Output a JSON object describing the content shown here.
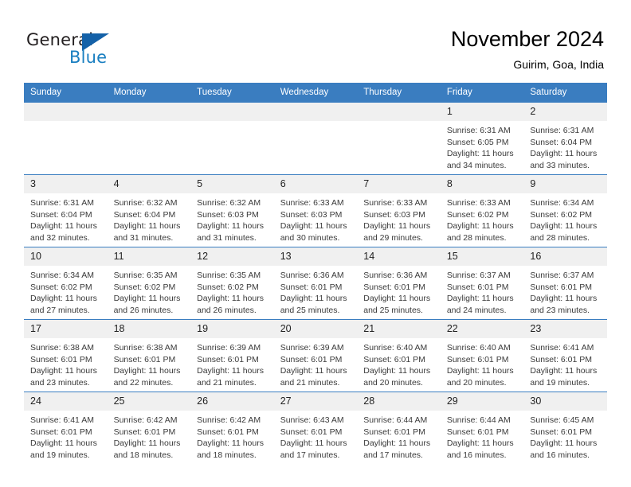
{
  "branding": {
    "logo_text_primary": "General",
    "logo_text_secondary": "Blue",
    "logo_accent_color": "#1461a8",
    "logo_secondary_color": "#1a7fc1"
  },
  "header": {
    "month_title": "November 2024",
    "location": "Guirim, Goa, India"
  },
  "calendar": {
    "header_background": "#3a7dc0",
    "daycell_background": "#f0f0f0",
    "weekdays": [
      "Sunday",
      "Monday",
      "Tuesday",
      "Wednesday",
      "Thursday",
      "Friday",
      "Saturday"
    ],
    "weeks": [
      [
        {
          "day": "",
          "empty": true
        },
        {
          "day": "",
          "empty": true
        },
        {
          "day": "",
          "empty": true
        },
        {
          "day": "",
          "empty": true
        },
        {
          "day": "",
          "empty": true
        },
        {
          "day": "1",
          "sunrise": "Sunrise: 6:31 AM",
          "sunset": "Sunset: 6:05 PM",
          "daylight": "Daylight: 11 hours and 34 minutes."
        },
        {
          "day": "2",
          "sunrise": "Sunrise: 6:31 AM",
          "sunset": "Sunset: 6:04 PM",
          "daylight": "Daylight: 11 hours and 33 minutes."
        }
      ],
      [
        {
          "day": "3",
          "sunrise": "Sunrise: 6:31 AM",
          "sunset": "Sunset: 6:04 PM",
          "daylight": "Daylight: 11 hours and 32 minutes."
        },
        {
          "day": "4",
          "sunrise": "Sunrise: 6:32 AM",
          "sunset": "Sunset: 6:04 PM",
          "daylight": "Daylight: 11 hours and 31 minutes."
        },
        {
          "day": "5",
          "sunrise": "Sunrise: 6:32 AM",
          "sunset": "Sunset: 6:03 PM",
          "daylight": "Daylight: 11 hours and 31 minutes."
        },
        {
          "day": "6",
          "sunrise": "Sunrise: 6:33 AM",
          "sunset": "Sunset: 6:03 PM",
          "daylight": "Daylight: 11 hours and 30 minutes."
        },
        {
          "day": "7",
          "sunrise": "Sunrise: 6:33 AM",
          "sunset": "Sunset: 6:03 PM",
          "daylight": "Daylight: 11 hours and 29 minutes."
        },
        {
          "day": "8",
          "sunrise": "Sunrise: 6:33 AM",
          "sunset": "Sunset: 6:02 PM",
          "daylight": "Daylight: 11 hours and 28 minutes."
        },
        {
          "day": "9",
          "sunrise": "Sunrise: 6:34 AM",
          "sunset": "Sunset: 6:02 PM",
          "daylight": "Daylight: 11 hours and 28 minutes."
        }
      ],
      [
        {
          "day": "10",
          "sunrise": "Sunrise: 6:34 AM",
          "sunset": "Sunset: 6:02 PM",
          "daylight": "Daylight: 11 hours and 27 minutes."
        },
        {
          "day": "11",
          "sunrise": "Sunrise: 6:35 AM",
          "sunset": "Sunset: 6:02 PM",
          "daylight": "Daylight: 11 hours and 26 minutes."
        },
        {
          "day": "12",
          "sunrise": "Sunrise: 6:35 AM",
          "sunset": "Sunset: 6:02 PM",
          "daylight": "Daylight: 11 hours and 26 minutes."
        },
        {
          "day": "13",
          "sunrise": "Sunrise: 6:36 AM",
          "sunset": "Sunset: 6:01 PM",
          "daylight": "Daylight: 11 hours and 25 minutes."
        },
        {
          "day": "14",
          "sunrise": "Sunrise: 6:36 AM",
          "sunset": "Sunset: 6:01 PM",
          "daylight": "Daylight: 11 hours and 25 minutes."
        },
        {
          "day": "15",
          "sunrise": "Sunrise: 6:37 AM",
          "sunset": "Sunset: 6:01 PM",
          "daylight": "Daylight: 11 hours and 24 minutes."
        },
        {
          "day": "16",
          "sunrise": "Sunrise: 6:37 AM",
          "sunset": "Sunset: 6:01 PM",
          "daylight": "Daylight: 11 hours and 23 minutes."
        }
      ],
      [
        {
          "day": "17",
          "sunrise": "Sunrise: 6:38 AM",
          "sunset": "Sunset: 6:01 PM",
          "daylight": "Daylight: 11 hours and 23 minutes."
        },
        {
          "day": "18",
          "sunrise": "Sunrise: 6:38 AM",
          "sunset": "Sunset: 6:01 PM",
          "daylight": "Daylight: 11 hours and 22 minutes."
        },
        {
          "day": "19",
          "sunrise": "Sunrise: 6:39 AM",
          "sunset": "Sunset: 6:01 PM",
          "daylight": "Daylight: 11 hours and 21 minutes."
        },
        {
          "day": "20",
          "sunrise": "Sunrise: 6:39 AM",
          "sunset": "Sunset: 6:01 PM",
          "daylight": "Daylight: 11 hours and 21 minutes."
        },
        {
          "day": "21",
          "sunrise": "Sunrise: 6:40 AM",
          "sunset": "Sunset: 6:01 PM",
          "daylight": "Daylight: 11 hours and 20 minutes."
        },
        {
          "day": "22",
          "sunrise": "Sunrise: 6:40 AM",
          "sunset": "Sunset: 6:01 PM",
          "daylight": "Daylight: 11 hours and 20 minutes."
        },
        {
          "day": "23",
          "sunrise": "Sunrise: 6:41 AM",
          "sunset": "Sunset: 6:01 PM",
          "daylight": "Daylight: 11 hours and 19 minutes."
        }
      ],
      [
        {
          "day": "24",
          "sunrise": "Sunrise: 6:41 AM",
          "sunset": "Sunset: 6:01 PM",
          "daylight": "Daylight: 11 hours and 19 minutes."
        },
        {
          "day": "25",
          "sunrise": "Sunrise: 6:42 AM",
          "sunset": "Sunset: 6:01 PM",
          "daylight": "Daylight: 11 hours and 18 minutes."
        },
        {
          "day": "26",
          "sunrise": "Sunrise: 6:42 AM",
          "sunset": "Sunset: 6:01 PM",
          "daylight": "Daylight: 11 hours and 18 minutes."
        },
        {
          "day": "27",
          "sunrise": "Sunrise: 6:43 AM",
          "sunset": "Sunset: 6:01 PM",
          "daylight": "Daylight: 11 hours and 17 minutes."
        },
        {
          "day": "28",
          "sunrise": "Sunrise: 6:44 AM",
          "sunset": "Sunset: 6:01 PM",
          "daylight": "Daylight: 11 hours and 17 minutes."
        },
        {
          "day": "29",
          "sunrise": "Sunrise: 6:44 AM",
          "sunset": "Sunset: 6:01 PM",
          "daylight": "Daylight: 11 hours and 16 minutes."
        },
        {
          "day": "30",
          "sunrise": "Sunrise: 6:45 AM",
          "sunset": "Sunset: 6:01 PM",
          "daylight": "Daylight: 11 hours and 16 minutes."
        }
      ]
    ]
  }
}
